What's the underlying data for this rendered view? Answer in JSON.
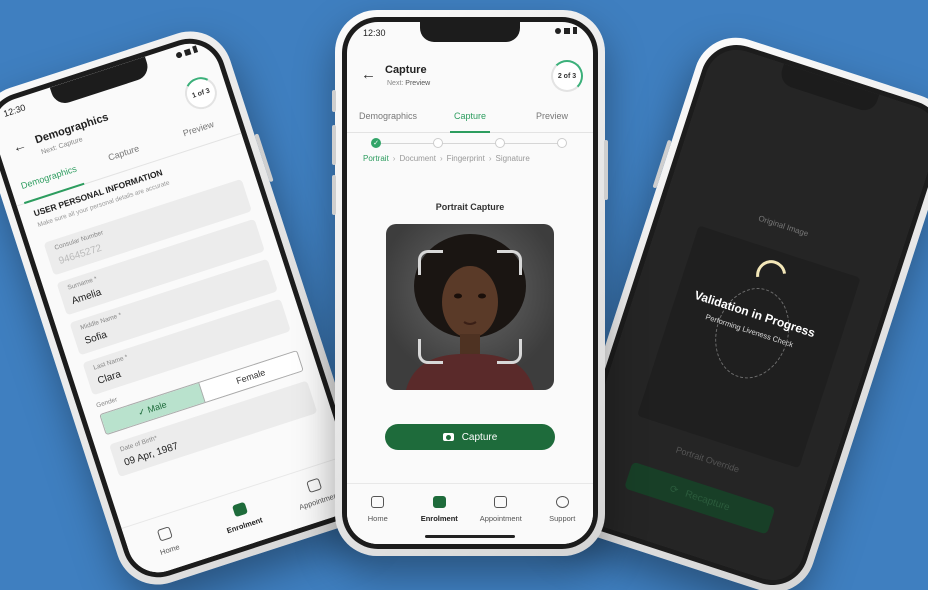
{
  "left": {
    "time": "12:30",
    "title": "Demographics",
    "next_prefix": "Next:",
    "next_value": "Capture",
    "step": "1 of 3",
    "tabs": [
      "Demographics",
      "Capture",
      "Preview"
    ],
    "section_title": "USER PERSONAL INFORMATION",
    "section_desc": "Make sure all your personal details are accurate",
    "fields": [
      {
        "label": "Consular Number",
        "value": "94645272"
      },
      {
        "label": "Surname *",
        "value": "Amelia"
      },
      {
        "label": "Middle Name *",
        "value": "Sofia"
      },
      {
        "label": "Last Name *",
        "value": "Clara"
      }
    ],
    "gender_label": "Gender",
    "gender_options": [
      "Male",
      "Female"
    ],
    "dob_label": "Date of Birth*",
    "dob_value": "09 Apr, 1987",
    "nav": [
      "Home",
      "Enrolment",
      "Appointment"
    ]
  },
  "center": {
    "time": "12:30",
    "title": "Capture",
    "next_prefix": "Next:",
    "next_value": "Preview",
    "step": "2 of 3",
    "tabs": [
      "Demographics",
      "Capture",
      "Preview"
    ],
    "steps": [
      "Portrait",
      "Document",
      "Fingerprint",
      "Signature"
    ],
    "portrait_label": "Portrait Capture",
    "capture_button": "Capture",
    "nav": [
      "Home",
      "Enrolment",
      "Appointment",
      "Support"
    ]
  },
  "right": {
    "original_label": "Original Image",
    "validation_title": "Validation in Progress",
    "validation_sub": "Performing Liveness Check",
    "portrait_override": "Portrait Override",
    "recapture_button": "Recapture"
  },
  "colors": {
    "background": "#3f7fc0",
    "accent": "#2d9d5f",
    "button": "#1e6b3b"
  }
}
